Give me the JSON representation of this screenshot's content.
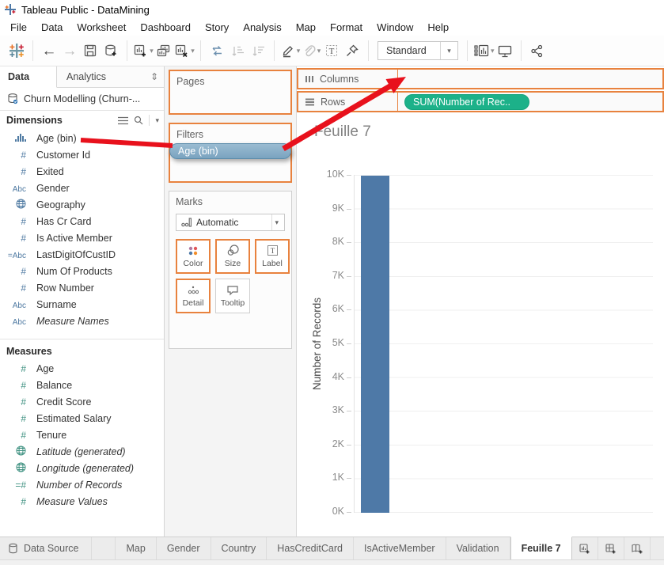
{
  "window": {
    "title": "Tableau Public - DataMining"
  },
  "menu": {
    "items": [
      {
        "label": "File"
      },
      {
        "label": "Data"
      },
      {
        "label": "Worksheet"
      },
      {
        "label": "Dashboard"
      },
      {
        "label": "Story"
      },
      {
        "label": "Analysis"
      },
      {
        "label": "Map"
      },
      {
        "label": "Format"
      },
      {
        "label": "Window"
      },
      {
        "label": "Help"
      }
    ]
  },
  "toolbar": {
    "glyphs": {
      "back": "←",
      "forward": "→",
      "caret": "▾",
      "swap_panes": "⇕"
    },
    "mode": {
      "value": "Standard"
    },
    "icons": [
      "tableau-logo",
      "undo",
      "redo",
      "save",
      "new-data-source",
      "new-worksheet",
      "duplicate-sheet",
      "clear-sheet",
      "swap-rows-columns",
      "sort-ascending",
      "sort-descending",
      "highlight",
      "group-members",
      "text-label",
      "fix-axes",
      "fit-selector",
      "show-me",
      "presentation-mode",
      "share"
    ]
  },
  "data_pane": {
    "tabs": {
      "data": "Data",
      "analytics": "Analytics"
    },
    "source": {
      "name": "Churn Modelling (Churn-..."
    },
    "icon_glyphs": {
      "number": "#",
      "text": "Abc",
      "calc_text": "=Abc",
      "calc_number": "=#"
    },
    "dimensions": {
      "header": "Dimensions",
      "items": [
        {
          "label": "Age (bin)",
          "icon": "histogram"
        },
        {
          "label": "Customer Id",
          "icon": "number"
        },
        {
          "label": "Exited",
          "icon": "number"
        },
        {
          "label": "Gender",
          "icon": "text"
        },
        {
          "label": "Geography",
          "icon": "globe"
        },
        {
          "label": "Has Cr Card",
          "icon": "number"
        },
        {
          "label": "Is Active Member",
          "icon": "number"
        },
        {
          "label": "LastDigitOfCustID",
          "icon": "calc_text"
        },
        {
          "label": "Num Of Products",
          "icon": "number"
        },
        {
          "label": "Row Number",
          "icon": "number"
        },
        {
          "label": "Surname",
          "icon": "text"
        },
        {
          "label": "Measure Names",
          "icon": "text",
          "italic": true
        }
      ]
    },
    "measures": {
      "header": "Measures",
      "items": [
        {
          "label": "Age",
          "icon": "number"
        },
        {
          "label": "Balance",
          "icon": "number"
        },
        {
          "label": "Credit Score",
          "icon": "number"
        },
        {
          "label": "Estimated Salary",
          "icon": "number"
        },
        {
          "label": "Tenure",
          "icon": "number"
        },
        {
          "label": "Latitude (generated)",
          "icon": "globe",
          "italic": true
        },
        {
          "label": "Longitude (generated)",
          "icon": "globe",
          "italic": true
        },
        {
          "label": "Number of Records",
          "icon": "calc_number",
          "italic": true
        },
        {
          "label": "Measure Values",
          "icon": "number",
          "italic": true
        }
      ]
    }
  },
  "shelves": {
    "pages": {
      "label": "Pages"
    },
    "filters": {
      "label": "Filters",
      "pills": [
        {
          "label": "Age (bin)"
        }
      ]
    },
    "marks": {
      "label": "Marks",
      "mark_type": "Automatic",
      "buttons": [
        {
          "label": "Color"
        },
        {
          "label": "Size"
        },
        {
          "label": "Label"
        },
        {
          "label": "Detail"
        },
        {
          "label": "Tooltip"
        }
      ]
    },
    "columns": {
      "label": "Columns",
      "pills": []
    },
    "rows": {
      "label": "Rows",
      "pills": [
        {
          "label": "SUM(Number of Rec.."
        }
      ]
    }
  },
  "sheet": {
    "title": "Feuille 7"
  },
  "chart_data": {
    "type": "bar",
    "title": "Feuille 7",
    "categories": [
      ""
    ],
    "values": [
      10000
    ],
    "series_label": "SUM(Number of Records)",
    "xlabel": "",
    "ylabel": "Number of Records",
    "ylim": [
      0,
      10500
    ],
    "yticks": [
      "10K",
      "9K",
      "8K",
      "7K",
      "6K",
      "5K",
      "4K",
      "3K",
      "2K",
      "1K",
      "0K"
    ],
    "grid": true,
    "legend": "none",
    "bar_color": "#4e79a7"
  },
  "sheet_tabs": {
    "items": [
      {
        "label": "Data Source"
      },
      {
        "label": "Map"
      },
      {
        "label": "Gender"
      },
      {
        "label": "Country"
      },
      {
        "label": "HasCreditCard"
      },
      {
        "label": "IsActiveMember"
      },
      {
        "label": "Validation"
      },
      {
        "label": "Feuille 7",
        "active": true
      }
    ],
    "new_buttons": [
      "new-worksheet",
      "new-dashboard",
      "new-story"
    ]
  },
  "annotations": {
    "arrow_color": "#e8111c",
    "arrows": [
      {
        "from": "dimension Age (bin)",
        "to": "Filters shelf pill Age (bin)"
      },
      {
        "from": "Filters pill Age (bin)",
        "to": "Columns shelf"
      }
    ]
  },
  "colors": {
    "accent_orange": "#e8823e",
    "pill_green": "#1cb189",
    "pill_blue": "#7fa9c5",
    "bar_blue": "#4e79a7",
    "arrow_red": "#e8111c",
    "dimension_icon_blue": "#4f7aa2",
    "measure_icon_green": "#3f9181"
  }
}
